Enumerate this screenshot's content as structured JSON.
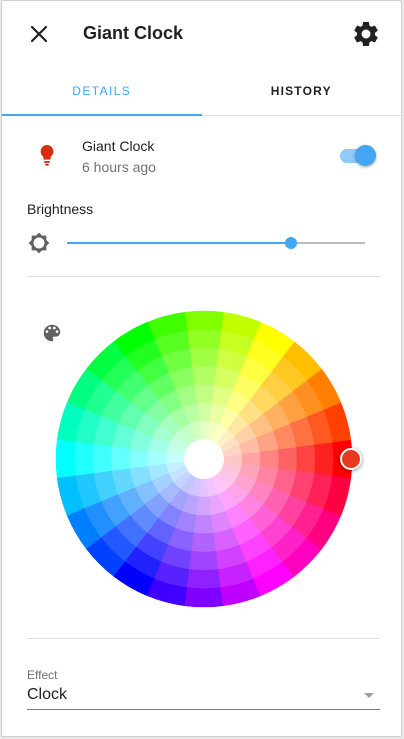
{
  "dialog": {
    "title": "Giant Clock",
    "close_icon": "close-icon",
    "settings_icon": "gear-icon"
  },
  "tabs": [
    {
      "label": "DETAILS",
      "active": true
    },
    {
      "label": "HISTORY",
      "active": false
    }
  ],
  "entity": {
    "name": "Giant Clock",
    "last_changed": "6 hours ago",
    "icon": "lightbulb-icon",
    "icon_color": "#d32f0f",
    "state_on": true
  },
  "brightness": {
    "label": "Brightness",
    "icon": "brightness-icon",
    "value_fraction": 0.75
  },
  "color": {
    "icon": "palette-icon",
    "selected_color": "#e8391e"
  },
  "effect": {
    "label": "Effect",
    "value": "Clock"
  },
  "theme": {
    "accent": "#42a5f5",
    "accent_light": "#90caf9"
  }
}
